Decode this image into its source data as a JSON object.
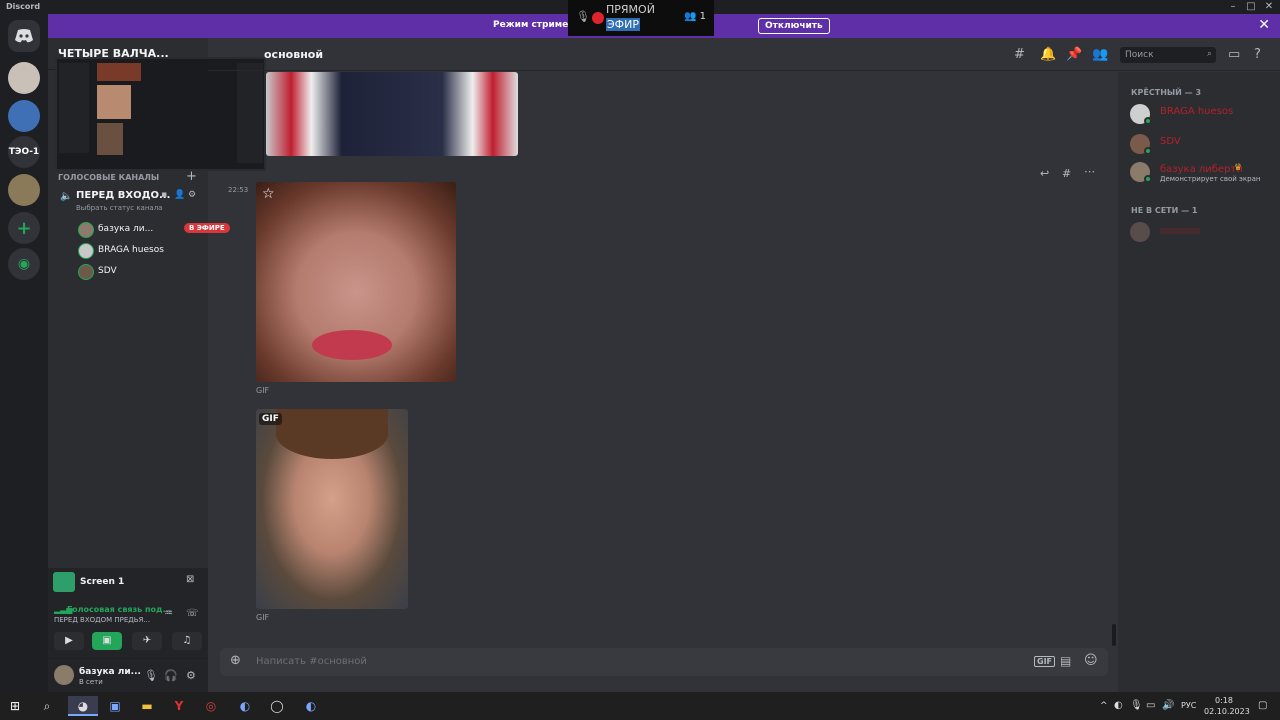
{
  "titlebar": {
    "app": "Discord"
  },
  "banner": {
    "text": "Режим стримера в... ...я скрыта.",
    "disable_label": "Отключить"
  },
  "live": {
    "line1": "ПРЯМОЙ",
    "line2": "ЭФИР",
    "viewers": "1"
  },
  "servers": [
    {
      "label": "ТЭО-1"
    }
  ],
  "channels": {
    "server_name": "ЧЕТЫРЕ ВАЛЧА...",
    "category": "ГОЛОСОВЫЕ КАНАЛЫ",
    "voice_channel": "ПЕРЕД ВХОДО...",
    "channel_status": "Выбрать статус канала",
    "voice_users": [
      {
        "name": "базука ли...",
        "badge": "В ЭФИРЕ"
      },
      {
        "name": "BRAGA huesos"
      },
      {
        "name": "SDV"
      }
    ]
  },
  "stream_tile": {
    "title": "Screen 1"
  },
  "voice_status": {
    "state": "Голосовая связь под...",
    "channel": "ПЕРЕД ВХОДОМ ПРЕДЬЯ..."
  },
  "user": {
    "name": "базука ли...",
    "status": "В сети"
  },
  "chat": {
    "channel": "основной",
    "timestamp": "22:53",
    "gif_label": "GIF",
    "gif_badge": "GIF",
    "composer_placeholder": "Написать #основной"
  },
  "header": {
    "search_placeholder": "Поиск"
  },
  "members": {
    "category_online": "КРЁСТНЫЙ — 3",
    "category_offline": "НЕ В СЕТИ — 1",
    "online": [
      {
        "name": "BRAGA huesos"
      },
      {
        "name": "SDV"
      },
      {
        "name": "базука либерти",
        "sub": "Демонстрирует свой экран"
      }
    ]
  },
  "taskbar": {
    "lang": "РУС",
    "time": "0:18",
    "date": "02.10.2023"
  },
  "colors": {
    "accent": "#5865f2",
    "banner": "#5f2fa8",
    "online": "#23a55a",
    "role": "#b5202a"
  }
}
